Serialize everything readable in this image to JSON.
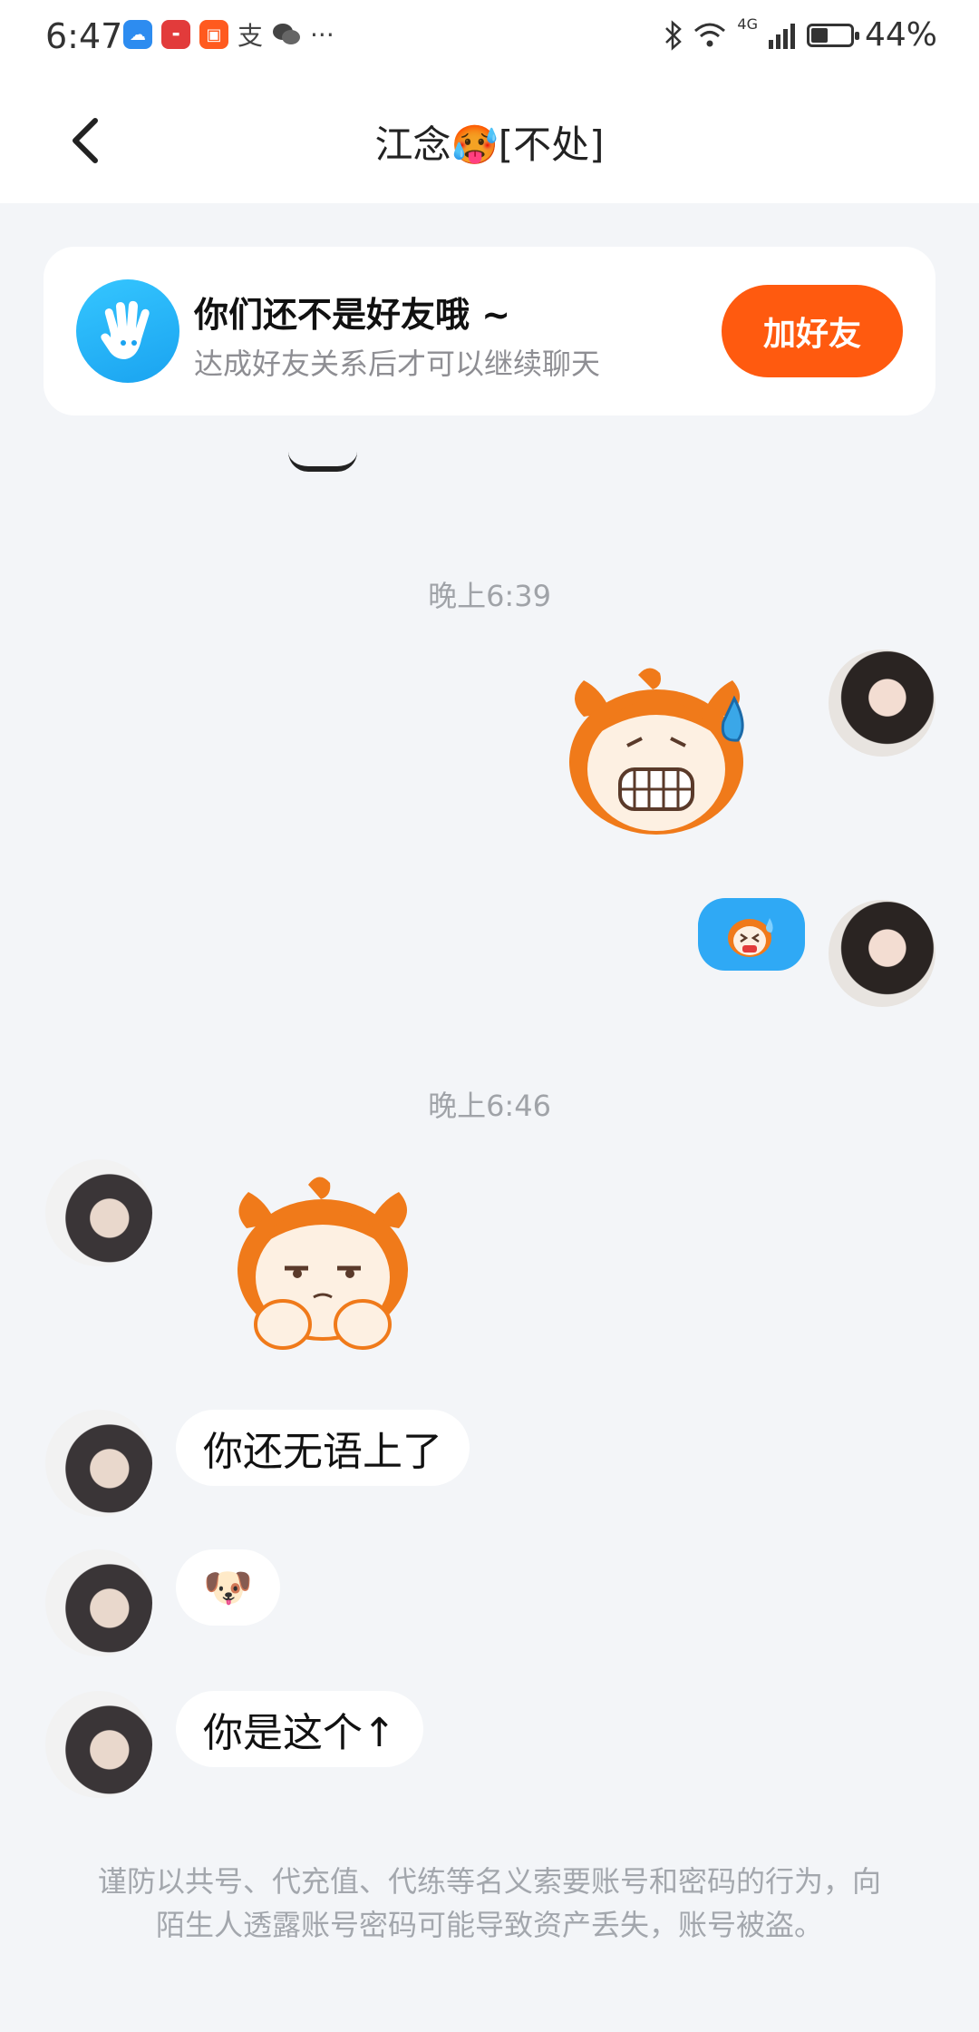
{
  "status_bar": {
    "time": "6:47",
    "notification_icons": [
      "cloud-icon",
      "huawei-icon",
      "kuaishou-icon",
      "alipay-icon",
      "wechat-icon",
      "more-icon"
    ],
    "alipay_glyph": "支",
    "more_glyph": "···",
    "network_label": "4G",
    "battery_percent": "44%",
    "battery_level": 0.44
  },
  "header": {
    "title": "江念🥵[不处]"
  },
  "friend_banner": {
    "title": "你们还不是好友哦 ~",
    "subtitle": "达成好友关系后才可以继续聊天",
    "button_label": "加好友",
    "button_color": "#ff5a0f"
  },
  "messages": {
    "timestamp_1": "晚上6:39",
    "timestamp_2": "晚上6:46",
    "text_1": "你还无语上了",
    "emoji_1": "🐶",
    "text_2": "你是这个↑"
  },
  "disclaimer": "谨防以共号、代充值、代练等名义索要账号和密码的行为，向陌生人透露账号密码可能导致资产丢失，账号被盗。",
  "colors": {
    "accent_blue": "#2fa9f5",
    "background": "#f3f5f8"
  }
}
